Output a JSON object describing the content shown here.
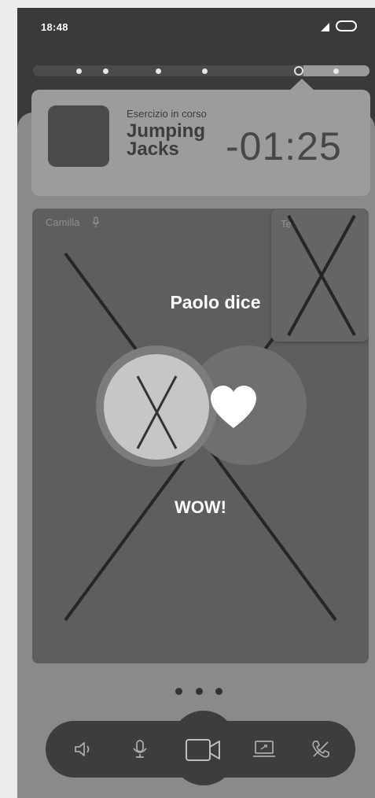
{
  "status_bar": {
    "time": "18:48"
  },
  "progress": {
    "total_steps": 7,
    "current_step": 6
  },
  "exercise": {
    "label": "Esercizio in corso",
    "name": "Jumping Jacks",
    "timer": "-01:25"
  },
  "video": {
    "main_participant": "Camilla",
    "pip_participant": "Te",
    "reaction_title": "Paolo dice",
    "reaction_word": "WOW!"
  },
  "icons": {
    "speaker": "speaker-icon",
    "mic": "mic-icon",
    "camera": "video-camera-icon",
    "screen": "screen-share-icon",
    "hangup": "hang-up-icon",
    "heart": "heart-icon"
  },
  "colors": {
    "background": "#3a3a3a",
    "sheet": "#8a8a8a",
    "video": "#5e5e5e",
    "callbar": "#3d3d3d"
  }
}
